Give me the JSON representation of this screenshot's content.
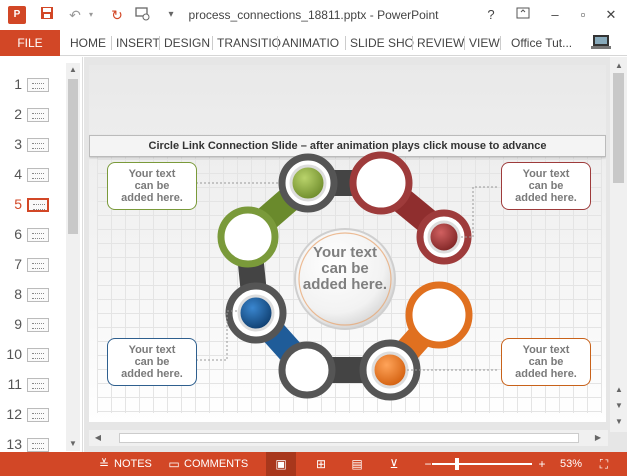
{
  "window": {
    "title": "process_connections_18811.pptx - PowerPoint",
    "help": "?",
    "minimize": "–",
    "restore": "▫",
    "close": "✕"
  },
  "qat": {
    "app_icon": "P",
    "save_icon": "floppy-disk-icon",
    "undo_icon": "undo-icon",
    "redo_icon": "redo-icon",
    "present_icon": "presentation-icon",
    "customize_icon": "chevron-down-icon"
  },
  "ribbon": {
    "file": "FILE",
    "tabs": [
      "HOME",
      "INSERT",
      "DESIGN",
      "TRANSITIO",
      "ANIMATIO",
      "SLIDE SHO",
      "REVIEW",
      "VIEW"
    ],
    "account": "Office Tut..."
  },
  "thumbnails": [
    "1",
    "2",
    "3",
    "4",
    "5",
    "6",
    "7",
    "8",
    "9",
    "10",
    "11",
    "12",
    "13"
  ],
  "active_slide": 5,
  "slide": {
    "header": "Circle Link Connection Slide – after animation plays click mouse to advance",
    "center_text": "Your text can be added here.",
    "callouts": [
      {
        "text": "Your text can be added here.",
        "color": "#7a9a3a"
      },
      {
        "text": "Your text can be added here.",
        "color": "#9e3b3b"
      },
      {
        "text": "Your text can be added here.",
        "color": "#2e5f8e"
      },
      {
        "text": "Your text can be added here.",
        "color": "#c8621a"
      }
    ],
    "ring_colors": {
      "green": "#7a9a3a",
      "red": "#9e3b3b",
      "blue": "#1f5c99",
      "orange": "#e0701f",
      "gray": "#555555"
    }
  },
  "statusbar": {
    "notes": "NOTES",
    "comments": "COMMENTS",
    "zoom": "53%",
    "color": "#d24726"
  }
}
